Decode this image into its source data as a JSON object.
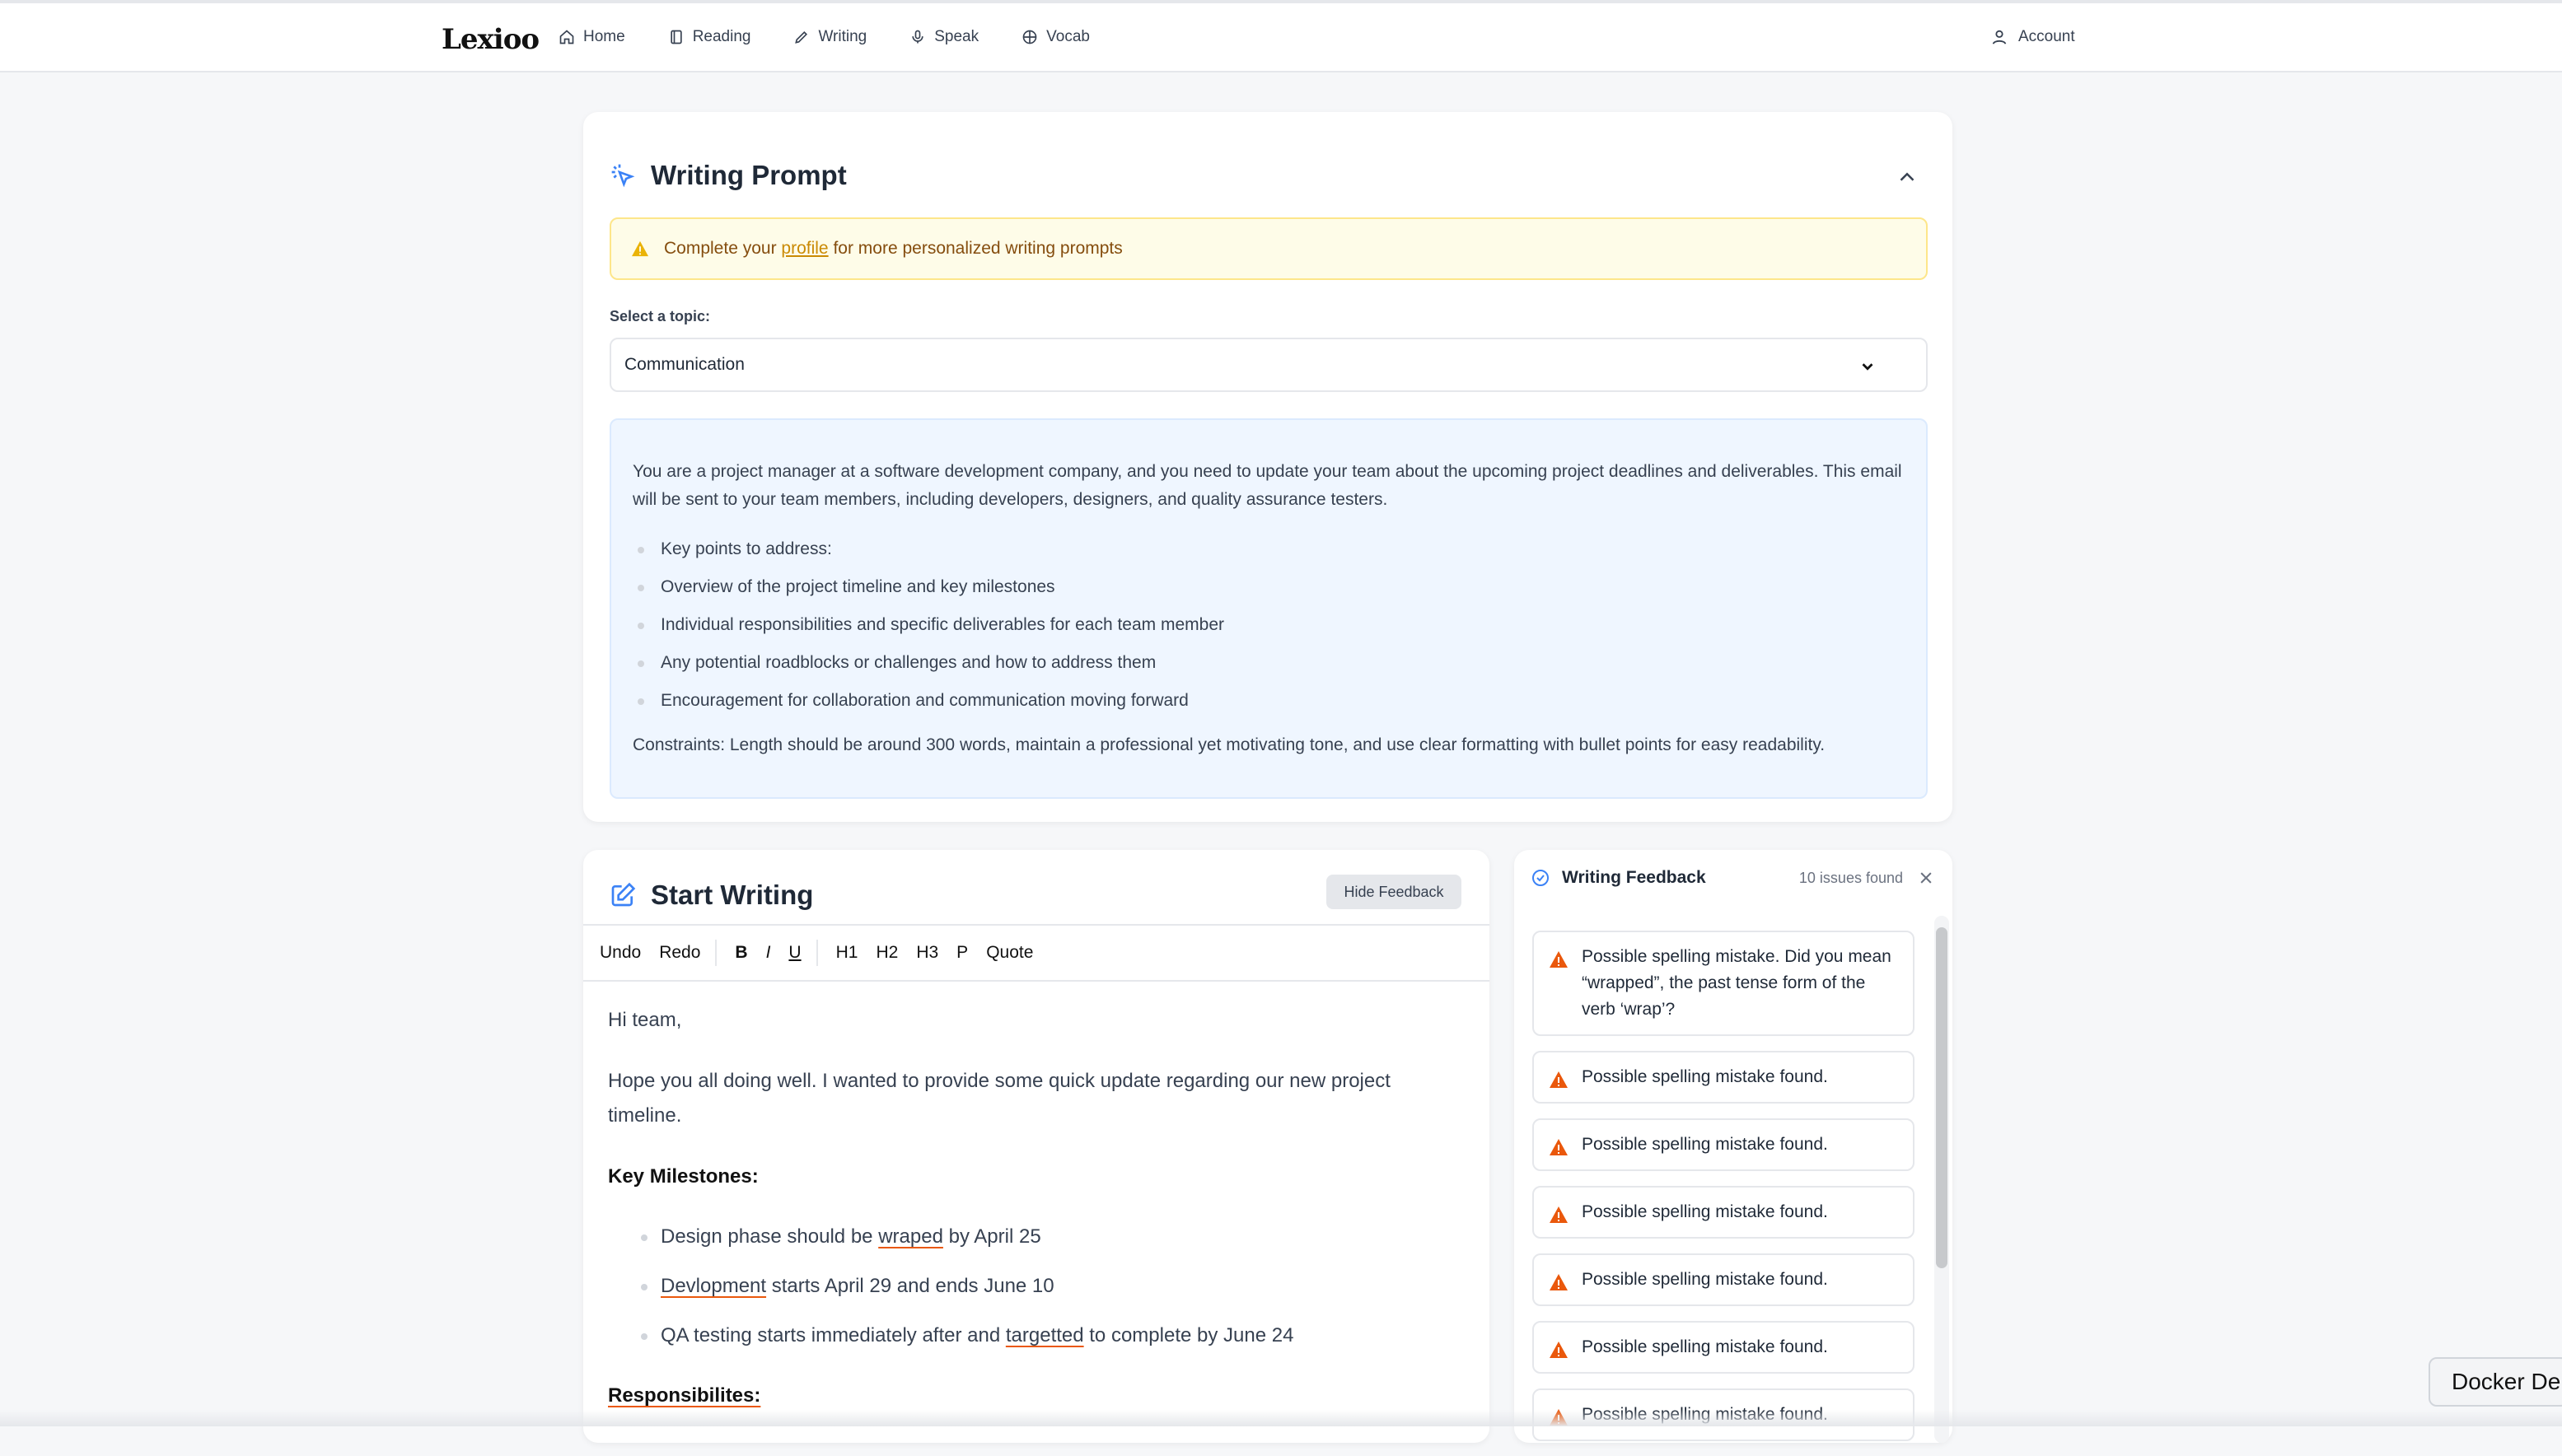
{
  "app": {
    "logo": "Lexioo"
  },
  "nav": {
    "items": [
      {
        "label": "Home",
        "icon": "home-icon"
      },
      {
        "label": "Reading",
        "icon": "book-icon"
      },
      {
        "label": "Writing",
        "icon": "pencil-icon"
      },
      {
        "label": "Speak",
        "icon": "mic-icon"
      },
      {
        "label": "Vocab",
        "icon": "globe-icon"
      }
    ],
    "account": "Account"
  },
  "prompt": {
    "title": "Writing Prompt",
    "alert_pre": "Complete your",
    "alert_link": "profile",
    "alert_post": "for more personalized writing prompts",
    "topic_label": "Select a topic:",
    "topic_value": "Communication",
    "intro": "You are a project manager at a software development company, and you need to update your team about the upcoming project deadlines and deliverables. This email will be sent to your team members, including developers, designers, and quality assurance testers.",
    "points": [
      "Key points to address:",
      "Overview of the project timeline and key milestones",
      "Individual responsibilities and specific deliverables for each team member",
      "Any potential roadblocks or challenges and how to address them",
      "Encouragement for collaboration and communication moving forward"
    ],
    "constraints": "Constraints: Length should be around 300 words, maintain a professional yet motivating tone, and use clear formatting with bullet points for easy readability."
  },
  "writing": {
    "title": "Start Writing",
    "hide_feedback": "Hide Feedback",
    "toolbar": [
      "Undo",
      "Redo",
      "B",
      "I",
      "U",
      "H1",
      "H2",
      "H3",
      "P",
      "Quote"
    ],
    "greeting": "Hi team,",
    "para1": "Hope you all doing well. I wanted to provide some quick update regarding our new project timeline.",
    "heading1": "Key Milestones:",
    "m1_pre": "Design phase should be",
    "m1_err": "wraped",
    "m1_post": "by April 25",
    "m2_err": "Devlopment",
    "m2_post": "starts April 29 and ends June 10",
    "m3_pre": "QA testing starts immediately after and",
    "m3_err": "targetted",
    "m3_post": "to complete by June 24",
    "heading2": "Responsibilites:"
  },
  "feedback": {
    "title": "Writing Feedback",
    "count": "10 issues found",
    "items": [
      "Possible spelling mistake. Did you mean “wrapped”, the past tense form of the verb ‘wrap’?",
      "Possible spelling mistake found.",
      "Possible spelling mistake found.",
      "Possible spelling mistake found.",
      "Possible spelling mistake found.",
      "Possible spelling mistake found.",
      "Possible spelling mistake found."
    ]
  },
  "overlay": {
    "docker": "Docker De"
  },
  "colors": {
    "accent": "#2563eb",
    "warning": "#ea580c",
    "alert_bg": "#fefce8"
  }
}
